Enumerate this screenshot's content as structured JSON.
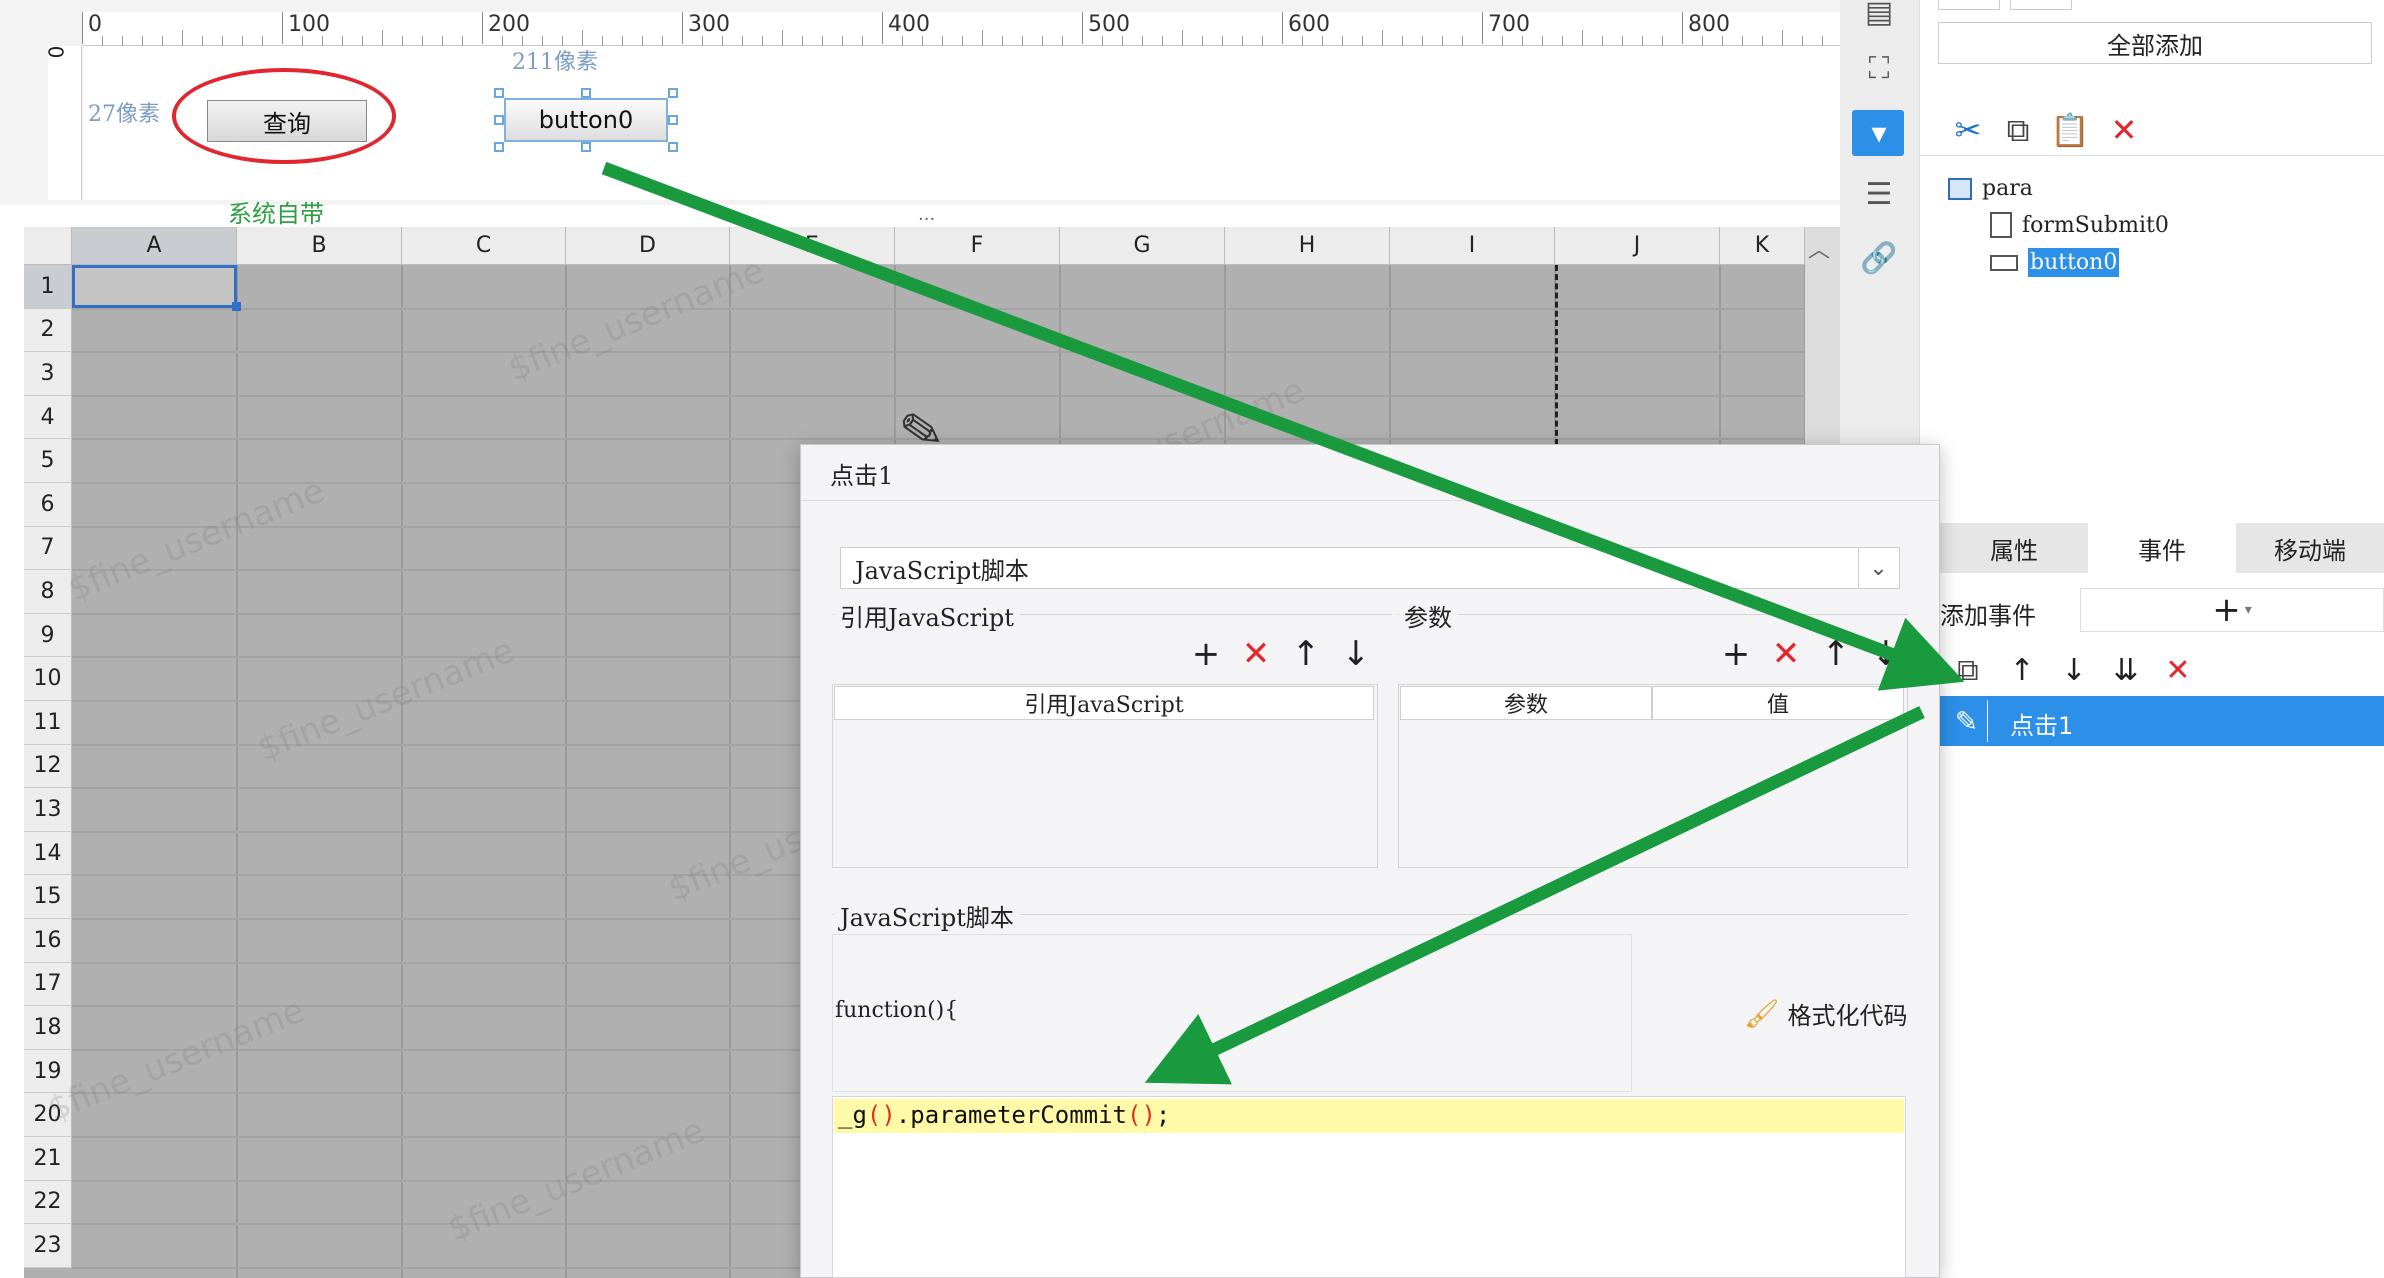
{
  "design": {
    "ruler_labels": [
      "0",
      "100",
      "200",
      "300",
      "400",
      "500",
      "600",
      "700",
      "800"
    ],
    "ruler_v_zero": "0",
    "height_label": "27像素",
    "width_label": "211像素",
    "query_button": "查询",
    "button0": "button0",
    "system_label": "系统自带",
    "splitter": "..."
  },
  "sheet": {
    "columns": [
      "A",
      "B",
      "C",
      "D",
      "E",
      "F",
      "G",
      "H",
      "I",
      "J",
      "K"
    ],
    "rows": [
      "1",
      "2",
      "3",
      "4",
      "5",
      "6",
      "7",
      "8",
      "9",
      "10",
      "11",
      "12",
      "13",
      "14",
      "15",
      "16",
      "17",
      "18",
      "19",
      "20",
      "21",
      "22",
      "23"
    ],
    "watermark": "$fine_username"
  },
  "toolcol": {
    "icons": [
      "widget-icon",
      "frame-icon",
      "dropdown-icon",
      "layout-icon",
      "link-icon"
    ]
  },
  "right_panel": {
    "add_all": "全部添加",
    "tree": {
      "root": "para",
      "child1": "formSubmit0",
      "child2": "button0"
    },
    "tabs": [
      "属性",
      "事件",
      "移动端"
    ],
    "add_event_label": "添加事件",
    "add_event_plus": "+",
    "add_event_caret": "▾",
    "event_item": "点击1"
  },
  "dialog": {
    "title": "点击1",
    "type_value": "JavaScript脚本",
    "ref_js_group": "引用JavaScript",
    "params_group": "参数",
    "ref_js_col": "引用JavaScript",
    "param_col": "参数",
    "value_col": "值",
    "script_group": "JavaScript脚本",
    "function_text": "function(){",
    "format_code": "格式化代码",
    "code_prefix": "_g",
    "code_paren_open": "(",
    "code_paren_close": ")",
    "code_method": ".parameterCommit",
    "code_suffix": ";"
  },
  "colors": {
    "accent_blue": "#2c8fe8",
    "delete_red": "#e3262d",
    "arrow_green": "#1a9a3e",
    "code_highlight": "#fffaa8"
  }
}
